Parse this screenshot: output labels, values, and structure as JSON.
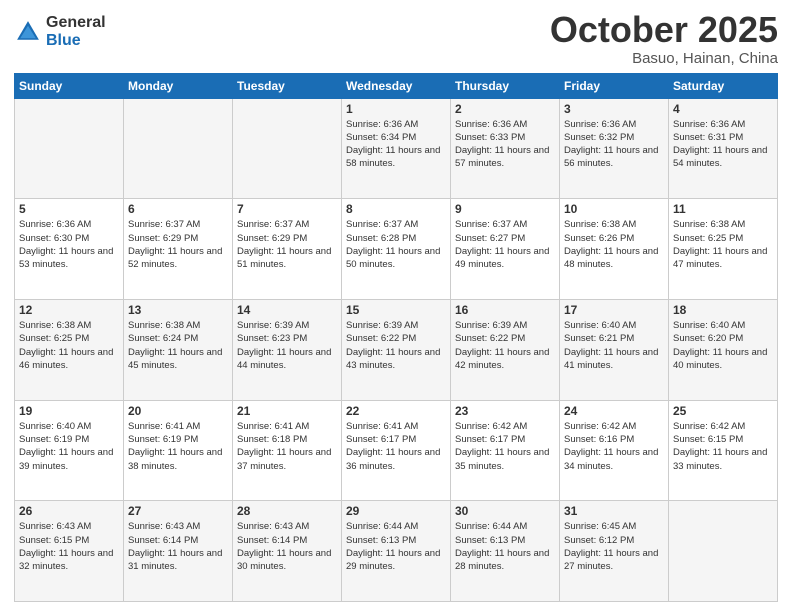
{
  "logo": {
    "general": "General",
    "blue": "Blue"
  },
  "header": {
    "month": "October 2025",
    "location": "Basuo, Hainan, China"
  },
  "weekdays": [
    "Sunday",
    "Monday",
    "Tuesday",
    "Wednesday",
    "Thursday",
    "Friday",
    "Saturday"
  ],
  "weeks": [
    [
      {
        "day": "",
        "sunrise": "",
        "sunset": "",
        "daylight": ""
      },
      {
        "day": "",
        "sunrise": "",
        "sunset": "",
        "daylight": ""
      },
      {
        "day": "",
        "sunrise": "",
        "sunset": "",
        "daylight": ""
      },
      {
        "day": "1",
        "sunrise": "Sunrise: 6:36 AM",
        "sunset": "Sunset: 6:34 PM",
        "daylight": "Daylight: 11 hours and 58 minutes."
      },
      {
        "day": "2",
        "sunrise": "Sunrise: 6:36 AM",
        "sunset": "Sunset: 6:33 PM",
        "daylight": "Daylight: 11 hours and 57 minutes."
      },
      {
        "day": "3",
        "sunrise": "Sunrise: 6:36 AM",
        "sunset": "Sunset: 6:32 PM",
        "daylight": "Daylight: 11 hours and 56 minutes."
      },
      {
        "day": "4",
        "sunrise": "Sunrise: 6:36 AM",
        "sunset": "Sunset: 6:31 PM",
        "daylight": "Daylight: 11 hours and 54 minutes."
      }
    ],
    [
      {
        "day": "5",
        "sunrise": "Sunrise: 6:36 AM",
        "sunset": "Sunset: 6:30 PM",
        "daylight": "Daylight: 11 hours and 53 minutes."
      },
      {
        "day": "6",
        "sunrise": "Sunrise: 6:37 AM",
        "sunset": "Sunset: 6:29 PM",
        "daylight": "Daylight: 11 hours and 52 minutes."
      },
      {
        "day": "7",
        "sunrise": "Sunrise: 6:37 AM",
        "sunset": "Sunset: 6:29 PM",
        "daylight": "Daylight: 11 hours and 51 minutes."
      },
      {
        "day": "8",
        "sunrise": "Sunrise: 6:37 AM",
        "sunset": "Sunset: 6:28 PM",
        "daylight": "Daylight: 11 hours and 50 minutes."
      },
      {
        "day": "9",
        "sunrise": "Sunrise: 6:37 AM",
        "sunset": "Sunset: 6:27 PM",
        "daylight": "Daylight: 11 hours and 49 minutes."
      },
      {
        "day": "10",
        "sunrise": "Sunrise: 6:38 AM",
        "sunset": "Sunset: 6:26 PM",
        "daylight": "Daylight: 11 hours and 48 minutes."
      },
      {
        "day": "11",
        "sunrise": "Sunrise: 6:38 AM",
        "sunset": "Sunset: 6:25 PM",
        "daylight": "Daylight: 11 hours and 47 minutes."
      }
    ],
    [
      {
        "day": "12",
        "sunrise": "Sunrise: 6:38 AM",
        "sunset": "Sunset: 6:25 PM",
        "daylight": "Daylight: 11 hours and 46 minutes."
      },
      {
        "day": "13",
        "sunrise": "Sunrise: 6:38 AM",
        "sunset": "Sunset: 6:24 PM",
        "daylight": "Daylight: 11 hours and 45 minutes."
      },
      {
        "day": "14",
        "sunrise": "Sunrise: 6:39 AM",
        "sunset": "Sunset: 6:23 PM",
        "daylight": "Daylight: 11 hours and 44 minutes."
      },
      {
        "day": "15",
        "sunrise": "Sunrise: 6:39 AM",
        "sunset": "Sunset: 6:22 PM",
        "daylight": "Daylight: 11 hours and 43 minutes."
      },
      {
        "day": "16",
        "sunrise": "Sunrise: 6:39 AM",
        "sunset": "Sunset: 6:22 PM",
        "daylight": "Daylight: 11 hours and 42 minutes."
      },
      {
        "day": "17",
        "sunrise": "Sunrise: 6:40 AM",
        "sunset": "Sunset: 6:21 PM",
        "daylight": "Daylight: 11 hours and 41 minutes."
      },
      {
        "day": "18",
        "sunrise": "Sunrise: 6:40 AM",
        "sunset": "Sunset: 6:20 PM",
        "daylight": "Daylight: 11 hours and 40 minutes."
      }
    ],
    [
      {
        "day": "19",
        "sunrise": "Sunrise: 6:40 AM",
        "sunset": "Sunset: 6:19 PM",
        "daylight": "Daylight: 11 hours and 39 minutes."
      },
      {
        "day": "20",
        "sunrise": "Sunrise: 6:41 AM",
        "sunset": "Sunset: 6:19 PM",
        "daylight": "Daylight: 11 hours and 38 minutes."
      },
      {
        "day": "21",
        "sunrise": "Sunrise: 6:41 AM",
        "sunset": "Sunset: 6:18 PM",
        "daylight": "Daylight: 11 hours and 37 minutes."
      },
      {
        "day": "22",
        "sunrise": "Sunrise: 6:41 AM",
        "sunset": "Sunset: 6:17 PM",
        "daylight": "Daylight: 11 hours and 36 minutes."
      },
      {
        "day": "23",
        "sunrise": "Sunrise: 6:42 AM",
        "sunset": "Sunset: 6:17 PM",
        "daylight": "Daylight: 11 hours and 35 minutes."
      },
      {
        "day": "24",
        "sunrise": "Sunrise: 6:42 AM",
        "sunset": "Sunset: 6:16 PM",
        "daylight": "Daylight: 11 hours and 34 minutes."
      },
      {
        "day": "25",
        "sunrise": "Sunrise: 6:42 AM",
        "sunset": "Sunset: 6:15 PM",
        "daylight": "Daylight: 11 hours and 33 minutes."
      }
    ],
    [
      {
        "day": "26",
        "sunrise": "Sunrise: 6:43 AM",
        "sunset": "Sunset: 6:15 PM",
        "daylight": "Daylight: 11 hours and 32 minutes."
      },
      {
        "day": "27",
        "sunrise": "Sunrise: 6:43 AM",
        "sunset": "Sunset: 6:14 PM",
        "daylight": "Daylight: 11 hours and 31 minutes."
      },
      {
        "day": "28",
        "sunrise": "Sunrise: 6:43 AM",
        "sunset": "Sunset: 6:14 PM",
        "daylight": "Daylight: 11 hours and 30 minutes."
      },
      {
        "day": "29",
        "sunrise": "Sunrise: 6:44 AM",
        "sunset": "Sunset: 6:13 PM",
        "daylight": "Daylight: 11 hours and 29 minutes."
      },
      {
        "day": "30",
        "sunrise": "Sunrise: 6:44 AM",
        "sunset": "Sunset: 6:13 PM",
        "daylight": "Daylight: 11 hours and 28 minutes."
      },
      {
        "day": "31",
        "sunrise": "Sunrise: 6:45 AM",
        "sunset": "Sunset: 6:12 PM",
        "daylight": "Daylight: 11 hours and 27 minutes."
      },
      {
        "day": "",
        "sunrise": "",
        "sunset": "",
        "daylight": ""
      }
    ]
  ]
}
